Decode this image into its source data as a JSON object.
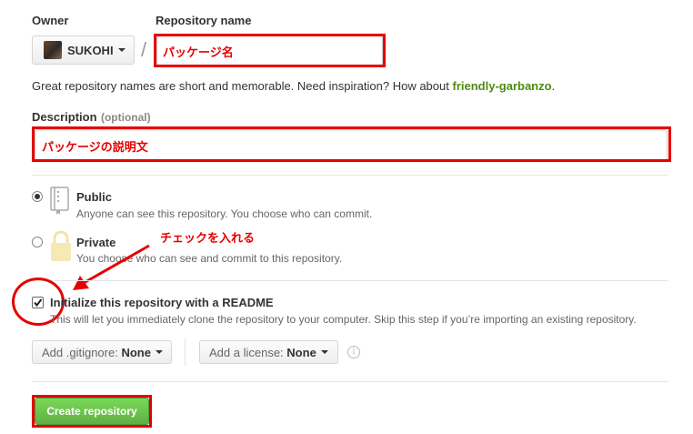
{
  "owner": {
    "label": "Owner",
    "value": "SUKOHI"
  },
  "separator": "/",
  "repo": {
    "label": "Repository name",
    "value": "パッケージ名"
  },
  "hint": {
    "text": "Great repository names are short and memorable. Need inspiration? How about",
    "suggestion": "friendly-garbanzo",
    "end": "."
  },
  "description": {
    "label": "Description",
    "optional": "(optional)",
    "value": "パッケージの説明文"
  },
  "visibility": {
    "public": {
      "title": "Public",
      "desc": "Anyone can see this repository. You choose who can commit.",
      "checked": true
    },
    "private": {
      "title": "Private",
      "desc": "You choose who can see and commit to this repository.",
      "checked": false
    }
  },
  "annotation": "チェックを入れる",
  "readme": {
    "title": "Initialize this repository with a README",
    "desc": "This will let you immediately clone the repository to your computer. Skip this step if you’re importing an existing repository.",
    "checked": true
  },
  "gitignore": {
    "label": "Add .gitignore:",
    "value": "None"
  },
  "license": {
    "label": "Add a license:",
    "value": "None"
  },
  "info_icon": "i",
  "create_button": "Create repository",
  "colors": {
    "accent_red": "#e60000",
    "suggestion_green": "#4f8a10",
    "button_green": "#6cc644"
  }
}
